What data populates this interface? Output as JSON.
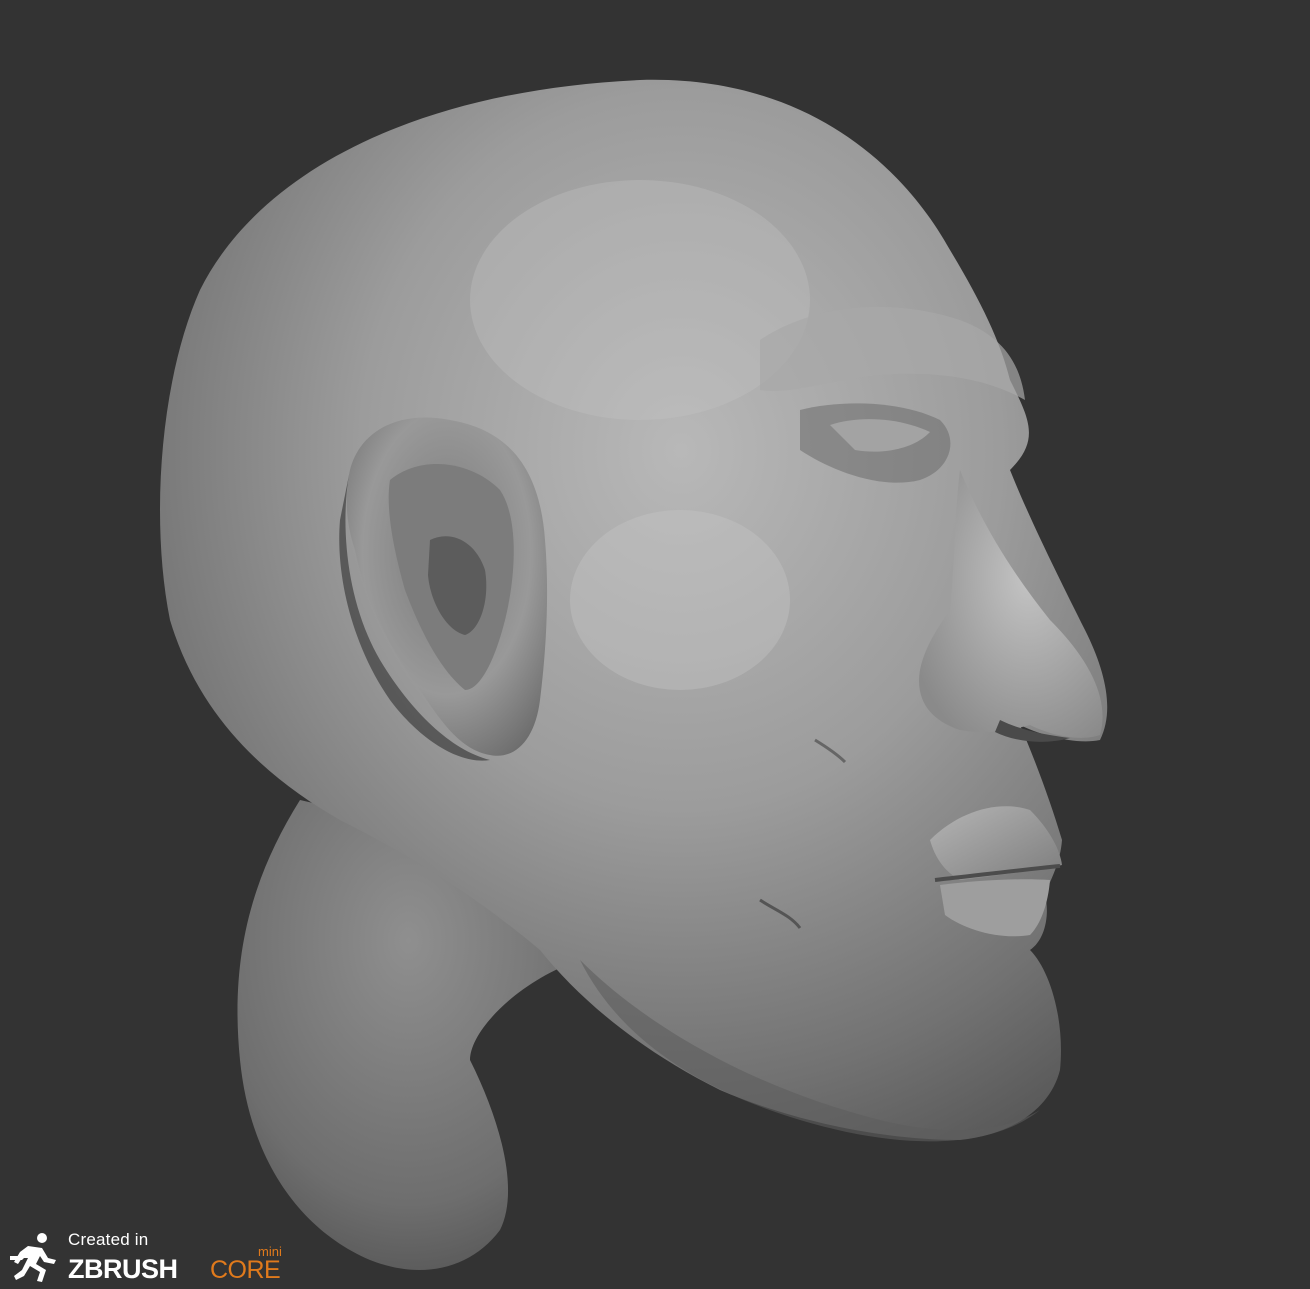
{
  "viewport": {
    "background": "#333333",
    "subject": "sculpted-head"
  },
  "watermark": {
    "created_in": "Created in",
    "brand": "ZBRUSH",
    "core": "CORE",
    "mini": "mini",
    "accent_color": "#e07a1c",
    "logo_icon": "zbrush-runner-icon"
  }
}
